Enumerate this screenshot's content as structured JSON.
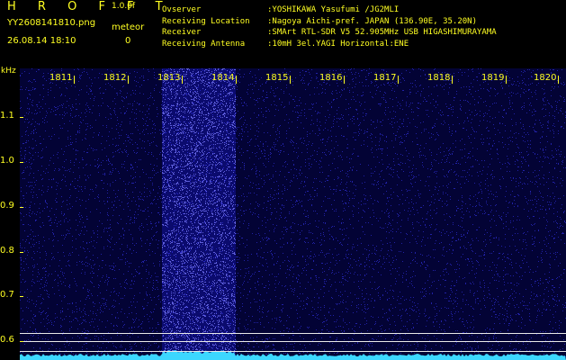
{
  "header": {
    "app_title": "H R O F F T",
    "app_version": "1.0.0f",
    "file_name": "YY2608141810.png",
    "meteor_label": "meteor",
    "datetime": "26.08.14 18:10",
    "meteor_count": "0"
  },
  "info": {
    "observer_label": "Ovserver",
    "observer_value": ":YOSHIKAWA Yasufumi /JG2MLI",
    "location_label": "Receiving Location",
    "location_value": ":Nagoya Aichi-pref. JAPAN (136.90E, 35.20N)",
    "receiver_label": "Receiver",
    "receiver_value": ":SMArt RTL-SDR V5 52.905MHz USB HIGASHIMURAYAMA",
    "antenna_label": "Receiving Antenna",
    "antenna_value": ":10mH 3el.YAGI Horizontal:ENE"
  },
  "axis": {
    "y_unit": "kHz",
    "y_ticks": [
      "1.1",
      "1.0",
      "0.9",
      "0.8",
      "0.7",
      "0.6"
    ],
    "x_ticks": [
      "1811",
      "1812",
      "1813",
      "1814",
      "1815",
      "1816",
      "1817",
      "1818",
      "1819",
      "1820"
    ]
  },
  "colors": {
    "text": "#ffff22",
    "background": "#000000",
    "waterfall_bg": "#030335",
    "noise": "#3a3aff",
    "spectrum_trace": "#3cd7ff"
  }
}
